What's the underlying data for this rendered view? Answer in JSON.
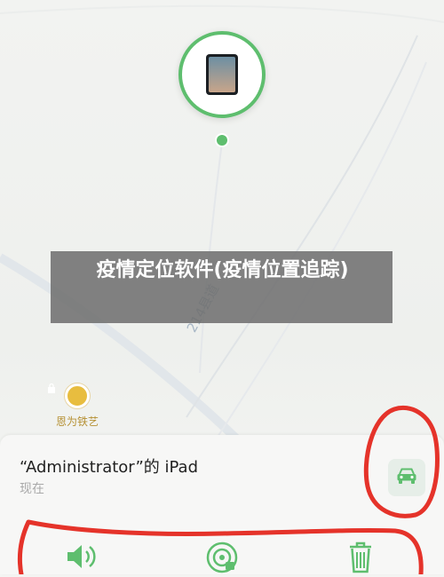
{
  "map": {
    "road_label": "214县道",
    "poi_label": "恩为铁艺"
  },
  "banner": {
    "title": "疫情定位软件(疫情位置追踪)"
  },
  "sheet": {
    "device_name": "“Administrator”的 iPad",
    "device_status": "现在"
  },
  "icons": {
    "directions": "car-icon",
    "play_sound": "speaker-icon",
    "lost_mode": "radar-lock-icon",
    "erase": "trash-icon",
    "device": "ipad-icon"
  },
  "colors": {
    "accent_green": "#5ebe6e",
    "annotation_red": "#e5332a",
    "road_label": "#a8b7c6",
    "poi": "#e8bd3f"
  }
}
